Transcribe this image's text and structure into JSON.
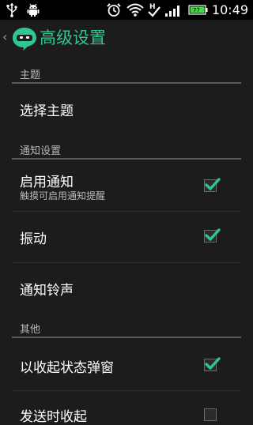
{
  "statusbar": {
    "time": "10:49",
    "battery_level": "77",
    "network_type": "H",
    "icons": [
      "usb-icon",
      "android-debug-icon",
      "alarm-icon",
      "wifi-icon",
      "data-h-icon",
      "signal-icon",
      "battery-icon"
    ]
  },
  "actionbar": {
    "title": "高级设置",
    "accent_color": "#2fc693"
  },
  "sections": [
    {
      "header": "主题",
      "items": [
        {
          "title": "选择主题"
        }
      ]
    },
    {
      "header": "通知设置",
      "items": [
        {
          "title": "启用通知",
          "summary": "触摸可启用通知提醒",
          "checked": true
        },
        {
          "title": "振动",
          "checked": true
        },
        {
          "title": "通知铃声"
        }
      ]
    },
    {
      "header": "其他",
      "items": [
        {
          "title": "以收起状态弹窗",
          "checked": true
        },
        {
          "title": "发送时收起",
          "checked": false
        }
      ]
    }
  ],
  "colors": {
    "background": "#1c1c1c",
    "checkmark": "#2fc693",
    "section_text": "#b9b9b9"
  }
}
